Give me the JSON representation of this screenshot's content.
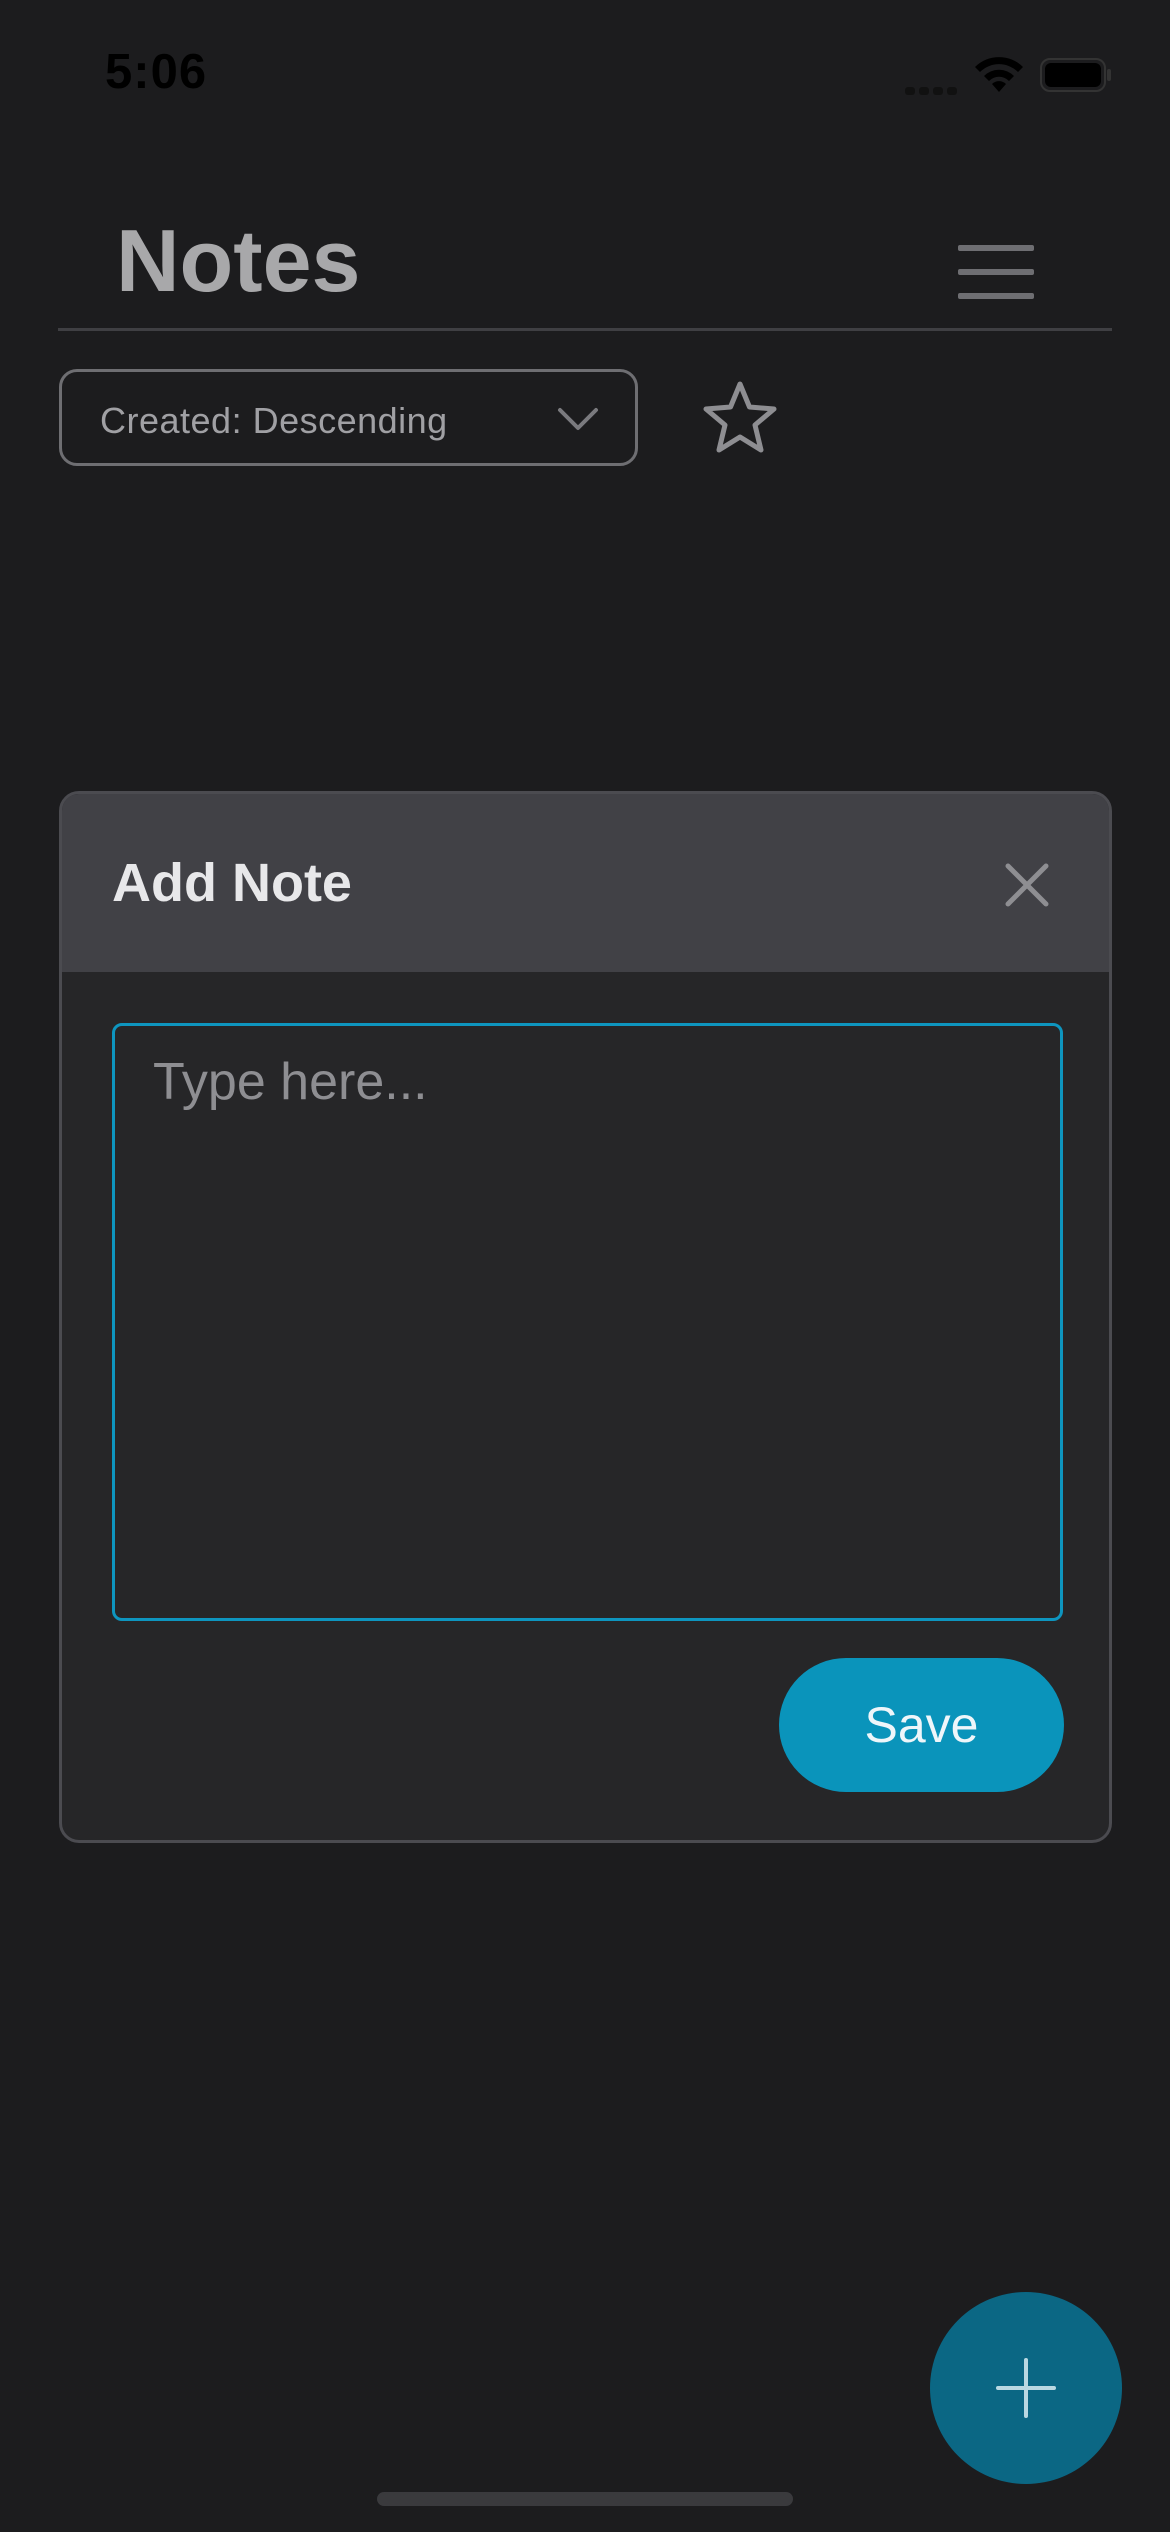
{
  "status_bar": {
    "time": "5:06"
  },
  "header": {
    "title": "Notes"
  },
  "sort": {
    "selected": "Created: Descending"
  },
  "modal": {
    "title": "Add Note",
    "textarea_placeholder": "Type here...",
    "textarea_value": "",
    "save_label": "Save"
  },
  "colors": {
    "accent": "#0a94bb",
    "fab": "#0b6784",
    "background": "#1c1c1e",
    "modal_header": "#414146"
  },
  "icons": {
    "menu": "hamburger-icon",
    "sort": "chevron-down-icon",
    "favorites": "star-outline-icon",
    "close": "close-icon",
    "fab": "plus-icon"
  }
}
